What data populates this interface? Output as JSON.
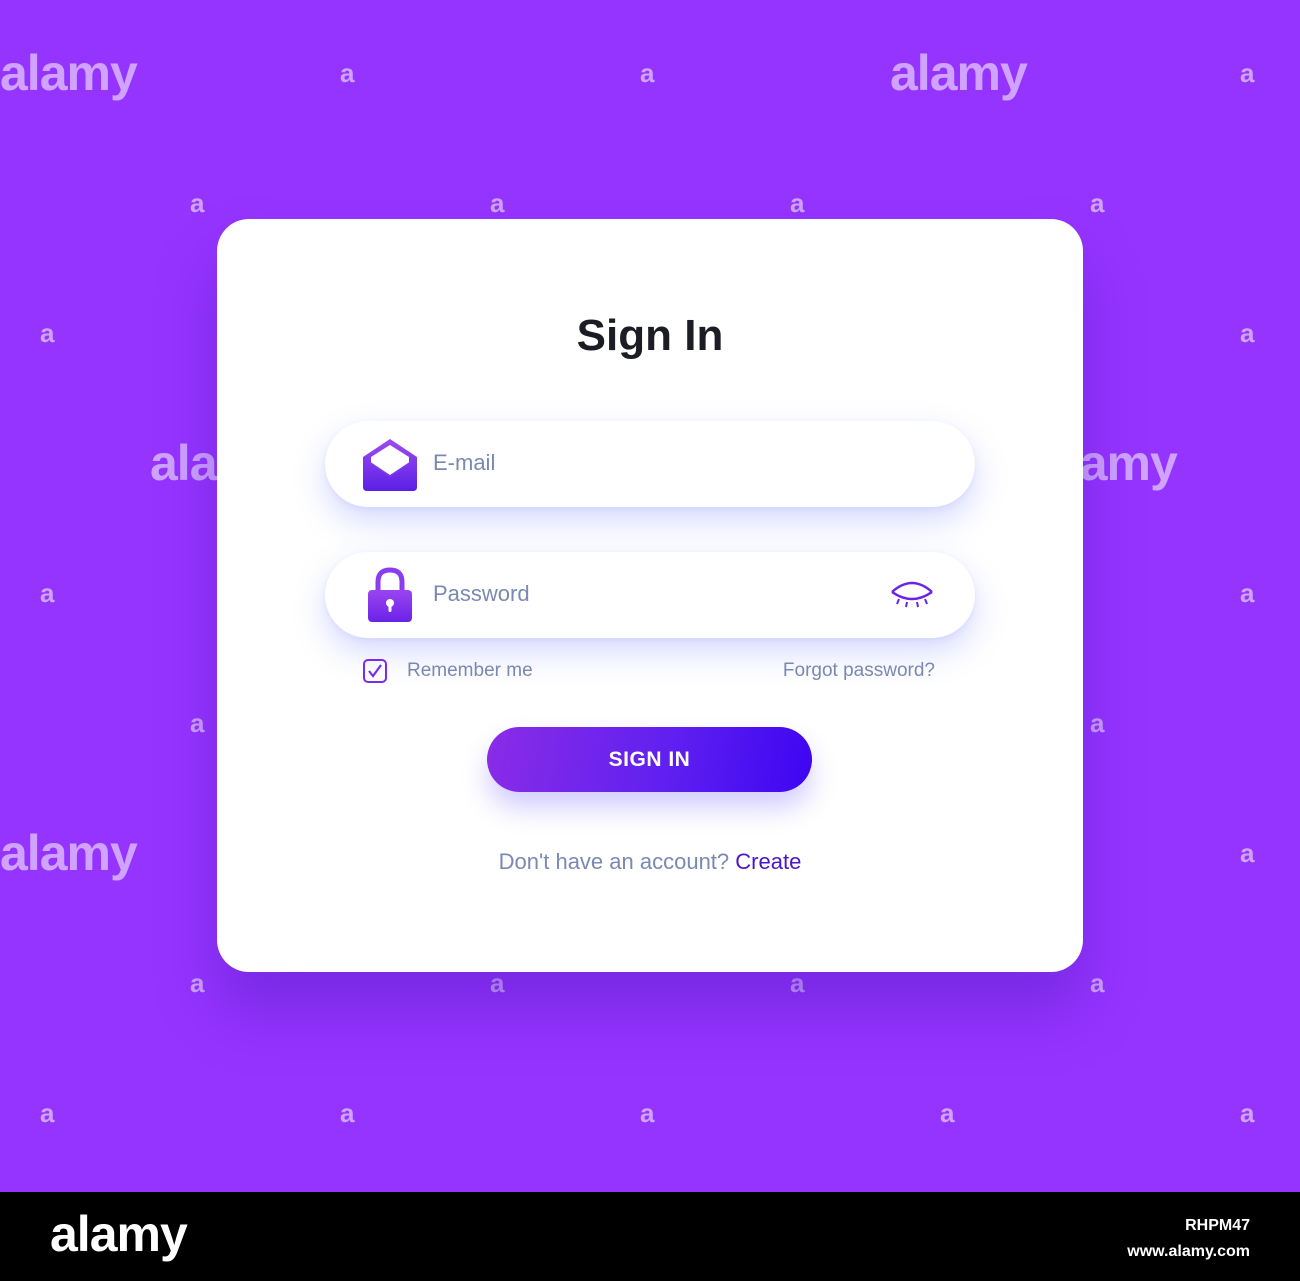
{
  "colors": {
    "background": "#9534ff",
    "card": "#ffffff",
    "accent": "#7a2ce8",
    "button_gradient_start": "#8a2ce6",
    "button_gradient_end": "#3d05f2",
    "placeholder_text": "#7a89b2",
    "title_text": "#1c1c24",
    "link": "#4b16c9"
  },
  "watermark": {
    "logo_text": "alamy",
    "small_mark": "a"
  },
  "card": {
    "title": "Sign In",
    "email": {
      "icon": "envelope-open-icon",
      "placeholder": "E-mail",
      "value": ""
    },
    "password": {
      "icon": "padlock-icon",
      "placeholder": "Password",
      "value": "",
      "toggle_icon": "eye-closed-icon"
    },
    "remember": {
      "label": "Remember me",
      "checked": true,
      "icon": "checkmark-icon"
    },
    "forgot_label": "Forgot password?",
    "submit_label": "SIGN IN",
    "footer": {
      "question": "Don't have an account?",
      "link": "Create"
    }
  },
  "stock_strip": {
    "logo": "alamy",
    "image_id": "RHPM47",
    "site": "www.alamy.com"
  }
}
